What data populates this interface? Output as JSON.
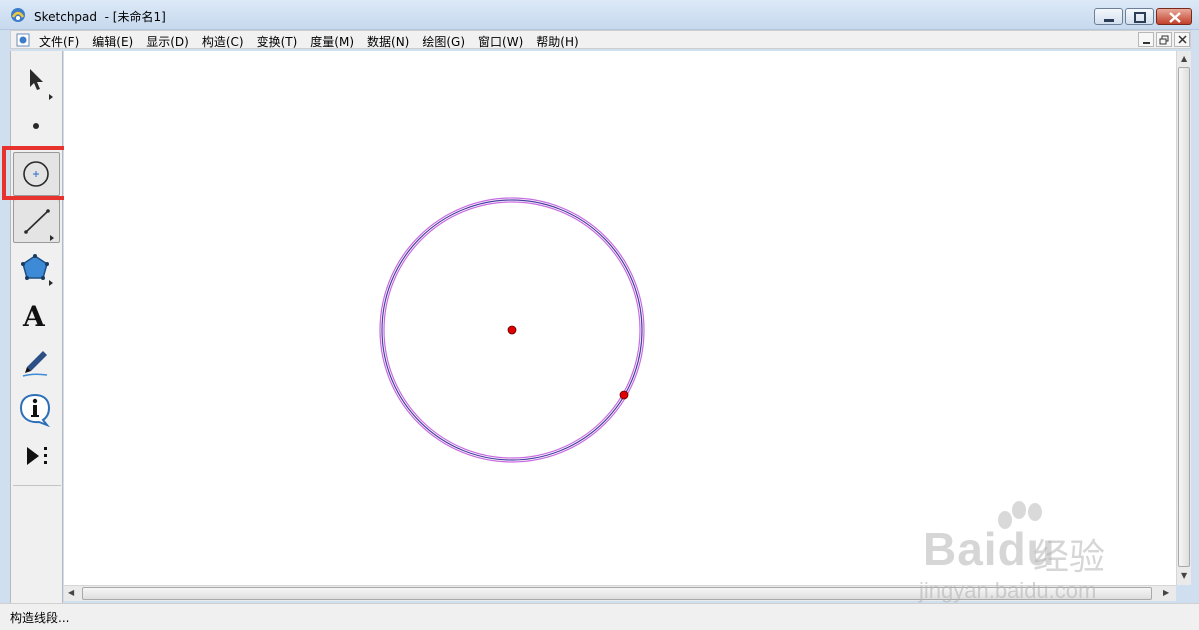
{
  "window": {
    "title": "Sketchpad  - [未命名1]"
  },
  "menu": {
    "items": [
      "文件(F)",
      "编辑(E)",
      "显示(D)",
      "构造(C)",
      "变换(T)",
      "度量(M)",
      "数据(N)",
      "绘图(G)",
      "窗口(W)",
      "帮助(H)"
    ]
  },
  "toolbox": {
    "tools": [
      "arrow-select-tool",
      "point-tool",
      "compass-tool",
      "straightedge-tool",
      "polygon-tool",
      "text-tool",
      "marker-tool",
      "information-tool",
      "custom-tool"
    ],
    "selected": "straightedge-tool",
    "highlight_color": "#e8322e"
  },
  "canvas": {
    "circle_color": "#b34fd6",
    "point_color": "#e00000"
  },
  "status": {
    "text": "构造线段..."
  },
  "watermark": {
    "brand": "Baidu",
    "cn": "经验",
    "url": "jingyan.baidu.com"
  }
}
